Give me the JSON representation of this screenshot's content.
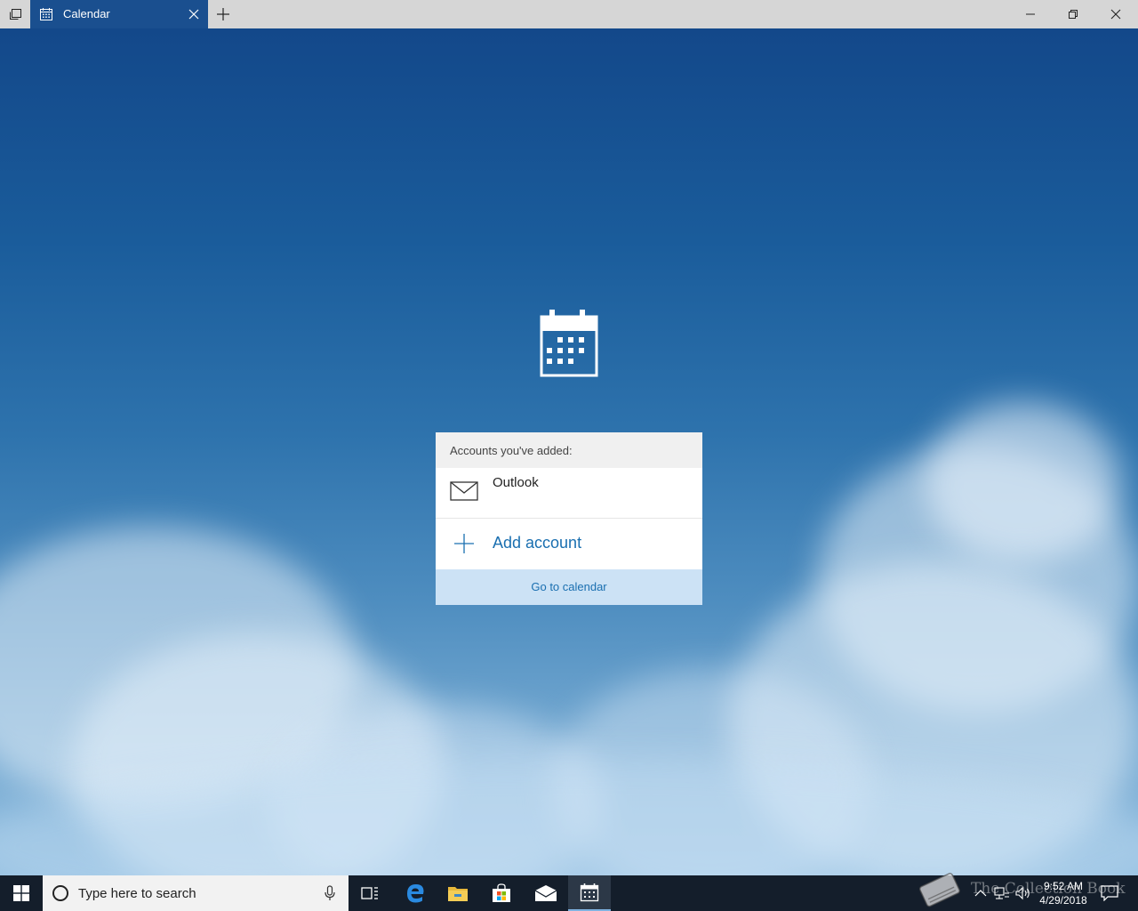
{
  "window": {
    "tab_title": "Calendar"
  },
  "accounts_panel": {
    "header": "Accounts you've added:",
    "accounts": [
      {
        "name": "Outlook",
        "icon": "mail-icon"
      }
    ],
    "add_account_label": "Add account",
    "go_to_calendar_label": "Go to calendar"
  },
  "taskbar": {
    "search_placeholder": "Type here to search",
    "clock": {
      "time": "9:52 AM",
      "date": "4/29/2018"
    }
  },
  "watermark": {
    "text": "The Collection Book"
  },
  "colors": {
    "accent": "#1a6fb0",
    "tab_active": "#1a4f8f",
    "go_to_calendar_bg": "#cce2f5",
    "taskbar_bg": "#141e2b"
  }
}
